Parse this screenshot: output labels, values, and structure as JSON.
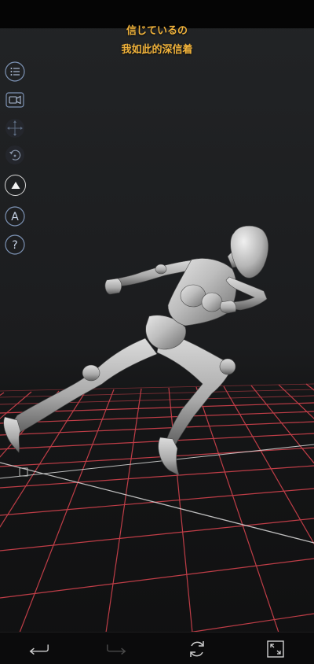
{
  "lyrics": {
    "line1": "信じているの",
    "line2": "我如此的深信着"
  },
  "toolbar": {
    "items": [
      {
        "icon": "list-icon",
        "active": false
      },
      {
        "icon": "video-camera-icon",
        "active": false
      },
      {
        "icon": "move-arrows-icon",
        "active": false
      },
      {
        "icon": "rotate-icon",
        "active": false
      },
      {
        "icon": "triangle-icon",
        "active": true
      },
      {
        "icon": "letter-a-icon",
        "active": false
      },
      {
        "icon": "help-icon",
        "active": false
      }
    ],
    "letter_a": "A",
    "help": "?"
  },
  "bottom_nav": {
    "items": [
      "undo-icon",
      "redo-icon",
      "refresh-icon",
      "fullscreen-icon"
    ]
  },
  "colors": {
    "lyrics": "#f0b23b",
    "grid": "#c9404a",
    "grid_axis": "#dcdcdc",
    "figure": "#b8b8b8",
    "background": "#1c1d1f"
  }
}
